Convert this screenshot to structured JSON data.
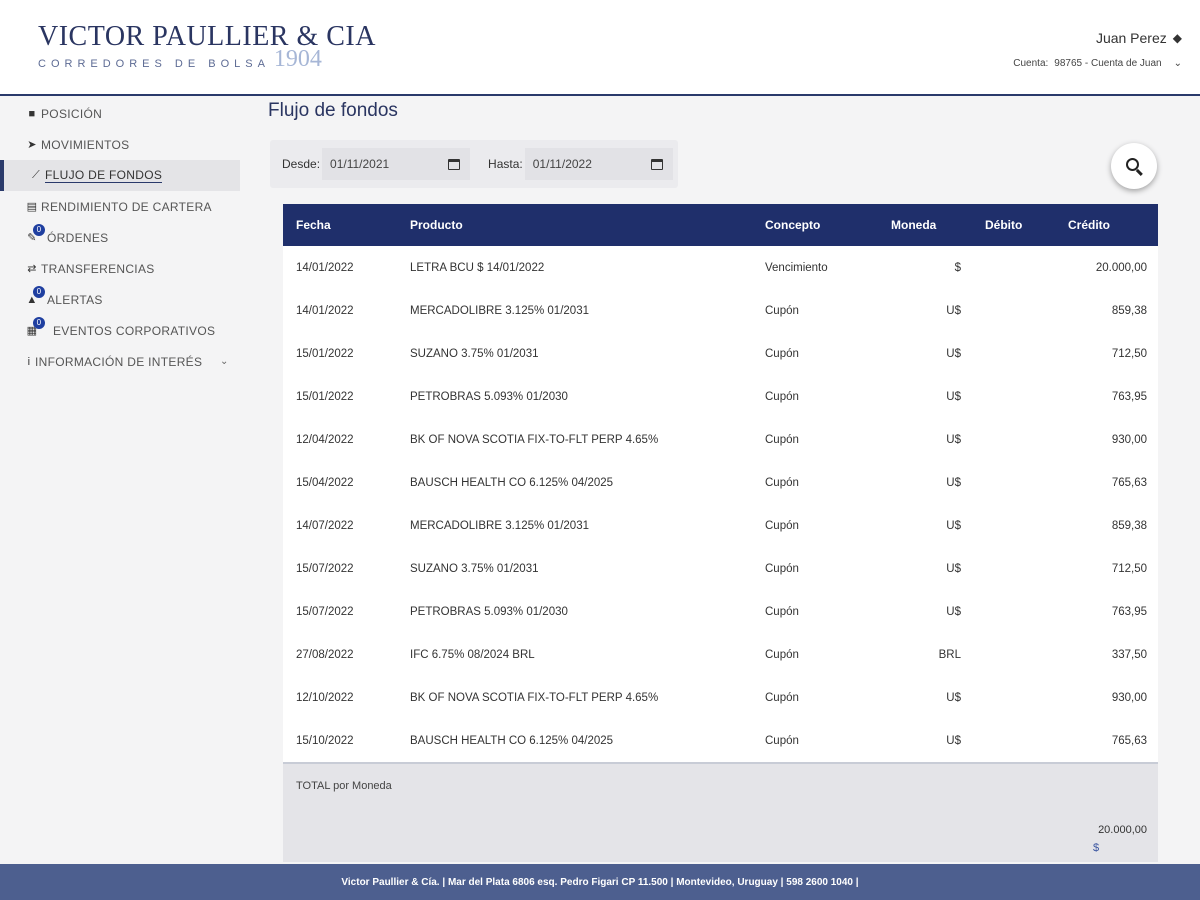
{
  "header": {
    "logo_main": "VICTOR PAULLIER & CIA",
    "logo_sub": "CORREDORES DE BOLSA",
    "logo_year": "1904",
    "user_name": "Juan Perez",
    "account_label": "Cuenta:",
    "account_value": "98765 - Cuenta de Juan"
  },
  "sidebar": {
    "items": [
      {
        "label": "POSICIÓN",
        "icon": "briefcase-icon"
      },
      {
        "label": "MOVIMIENTOS",
        "icon": "send-icon"
      },
      {
        "label": "FLUJO DE FONDOS",
        "icon": "chart-line-icon",
        "active": true
      },
      {
        "label": "RENDIMIENTO DE CARTERA",
        "icon": "document-icon"
      },
      {
        "label": "ÓRDENES",
        "icon": "edit-icon",
        "badge": "0"
      },
      {
        "label": "TRANSFERENCIAS",
        "icon": "transfer-icon"
      },
      {
        "label": "ALERTAS",
        "icon": "bell-icon",
        "badge": "0"
      },
      {
        "label": "EVENTOS CORPORATIVOS",
        "icon": "calendar-icon",
        "badge": "0"
      },
      {
        "label": "INFORMACIÓN DE INTERÉS",
        "icon": "info-icon"
      }
    ]
  },
  "main": {
    "title": "Flujo de fondos",
    "filters": {
      "desde_label": "Desde:",
      "desde_value": "01/11/2021",
      "hasta_label": "Hasta:",
      "hasta_value": "01/11/2022"
    },
    "table": {
      "headers": [
        "Fecha",
        "Producto",
        "Concepto",
        "Moneda",
        "Débito",
        "Crédito"
      ],
      "rows": [
        [
          "14/01/2022",
          "LETRA BCU $ 14/01/2022",
          "Vencimiento",
          "$",
          "",
          "20.000,00"
        ],
        [
          "14/01/2022",
          "MERCADOLIBRE 3.125% 01/2031",
          "Cupón",
          "U$",
          "",
          "859,38"
        ],
        [
          "15/01/2022",
          "SUZANO 3.75% 01/2031",
          "Cupón",
          "U$",
          "",
          "712,50"
        ],
        [
          "15/01/2022",
          "PETROBRAS 5.093% 01/2030",
          "Cupón",
          "U$",
          "",
          "763,95"
        ],
        [
          "12/04/2022",
          "BK OF NOVA SCOTIA FIX-TO-FLT PERP 4.65%",
          "Cupón",
          "U$",
          "",
          "930,00"
        ],
        [
          "15/04/2022",
          "BAUSCH HEALTH CO 6.125% 04/2025",
          "Cupón",
          "U$",
          "",
          "765,63"
        ],
        [
          "14/07/2022",
          "MERCADOLIBRE 3.125% 01/2031",
          "Cupón",
          "U$",
          "",
          "859,38"
        ],
        [
          "15/07/2022",
          "SUZANO 3.75% 01/2031",
          "Cupón",
          "U$",
          "",
          "712,50"
        ],
        [
          "15/07/2022",
          "PETROBRAS 5.093% 01/2030",
          "Cupón",
          "U$",
          "",
          "763,95"
        ],
        [
          "27/08/2022",
          "IFC 6.75% 08/2024 BRL",
          "Cupón",
          "BRL",
          "",
          "337,50"
        ],
        [
          "12/10/2022",
          "BK OF NOVA SCOTIA FIX-TO-FLT PERP 4.65%",
          "Cupón",
          "U$",
          "",
          "930,00"
        ],
        [
          "15/10/2022",
          "BAUSCH HEALTH CO 6.125% 04/2025",
          "Cupón",
          "U$",
          "",
          "765,63"
        ]
      ],
      "total_label": "TOTAL por Moneda",
      "total_value": "20.000,00",
      "total_currency": "$"
    }
  },
  "footer": {
    "text": "Victor Paullier & Cía. | Mar del Plata 6806 esq. Pedro Figari CP 11.500 | Montevideo, Uruguay | 598 2600 1040 |"
  },
  "colors": {
    "brand_navy": "#1f2f6b",
    "footer_bg": "#4d5f8f",
    "badge": "#1f3fa0"
  }
}
